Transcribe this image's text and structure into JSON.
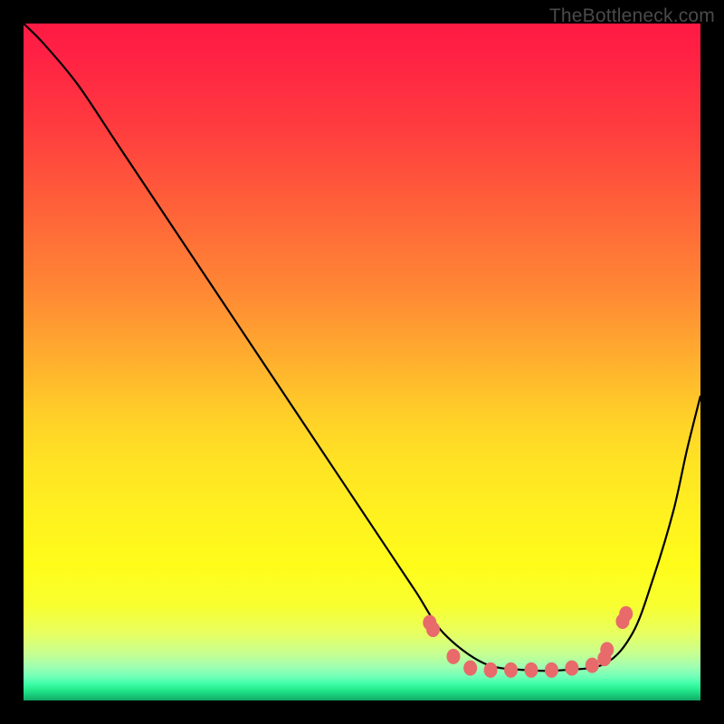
{
  "attribution": "TheBottleneck.com",
  "chart_data": {
    "type": "line",
    "title": "",
    "xlabel": "",
    "ylabel": "",
    "background_gradient": {
      "top": "#ff1a44",
      "mid": "#ffe324",
      "bottom": "#18c878"
    },
    "curve": {
      "note": "piecewise curve: steep descent left, flat minimum trough ~x 0.62-0.88, steep ascent right; x and y in 0..1 normalized plot coords (y=0 top, y=1 bottom)",
      "x": [
        0.0,
        0.03,
        0.08,
        0.14,
        0.22,
        0.3,
        0.38,
        0.46,
        0.54,
        0.58,
        0.62,
        0.68,
        0.74,
        0.8,
        0.86,
        0.9,
        0.93,
        0.96,
        0.98,
        1.0
      ],
      "y": [
        0.0,
        0.03,
        0.09,
        0.18,
        0.3,
        0.42,
        0.54,
        0.66,
        0.78,
        0.84,
        0.9,
        0.945,
        0.955,
        0.955,
        0.945,
        0.9,
        0.82,
        0.72,
        0.63,
        0.55
      ]
    },
    "markers": {
      "note": "coral-pink dots along the trough",
      "color": "#e86a6a",
      "x": [
        0.6,
        0.605,
        0.635,
        0.66,
        0.69,
        0.72,
        0.75,
        0.78,
        0.81,
        0.84,
        0.858,
        0.862,
        0.885,
        0.89
      ],
      "y": [
        0.885,
        0.895,
        0.935,
        0.952,
        0.955,
        0.955,
        0.955,
        0.955,
        0.952,
        0.948,
        0.938,
        0.925,
        0.883,
        0.872
      ]
    }
  }
}
